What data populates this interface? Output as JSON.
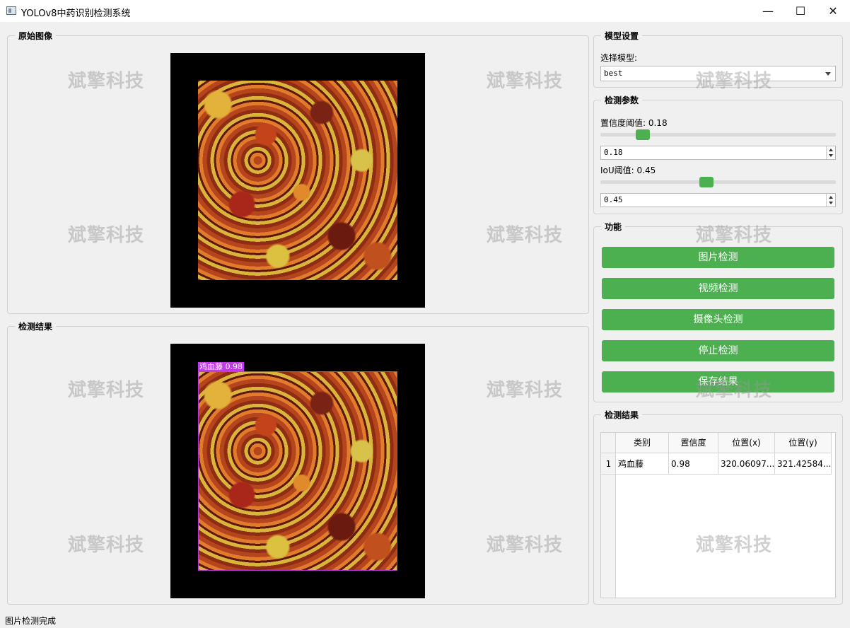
{
  "window": {
    "title": "YOLOv8中药识别检测系统",
    "minimize": "—",
    "maximize": "☐",
    "close": "✕"
  },
  "watermark": "斌擎科技",
  "original_panel": {
    "title": "原始图像"
  },
  "result_panel": {
    "title": "检测结果"
  },
  "detection_label": "鸡血藤 0.98",
  "model_group": {
    "title": "模型设置",
    "label": "选择模型:",
    "selected": "best"
  },
  "params_group": {
    "title": "检测参数",
    "conf_label": "置信度阈值: 0.18",
    "conf_value": "0.18",
    "conf_slider": 0.18,
    "iou_label": "IoU阈值: 0.45",
    "iou_value": "0.45",
    "iou_slider": 0.45
  },
  "function_group": {
    "title": "功能",
    "buttons": [
      "图片检测",
      "视频检测",
      "摄像头检测",
      "停止检测",
      "保存结果"
    ]
  },
  "results_group": {
    "title": "检测结果",
    "columns": [
      "类别",
      "置信度",
      "位置(x)",
      "位置(y)"
    ],
    "rows": [
      {
        "index": "1",
        "cells": [
          "鸡血藤",
          "0.98",
          "320.06097...",
          "321.42584..."
        ]
      }
    ]
  },
  "status": "图片检测完成",
  "colors": {
    "accent_green": "#4caf50",
    "box_purple": "#c13ae8"
  }
}
